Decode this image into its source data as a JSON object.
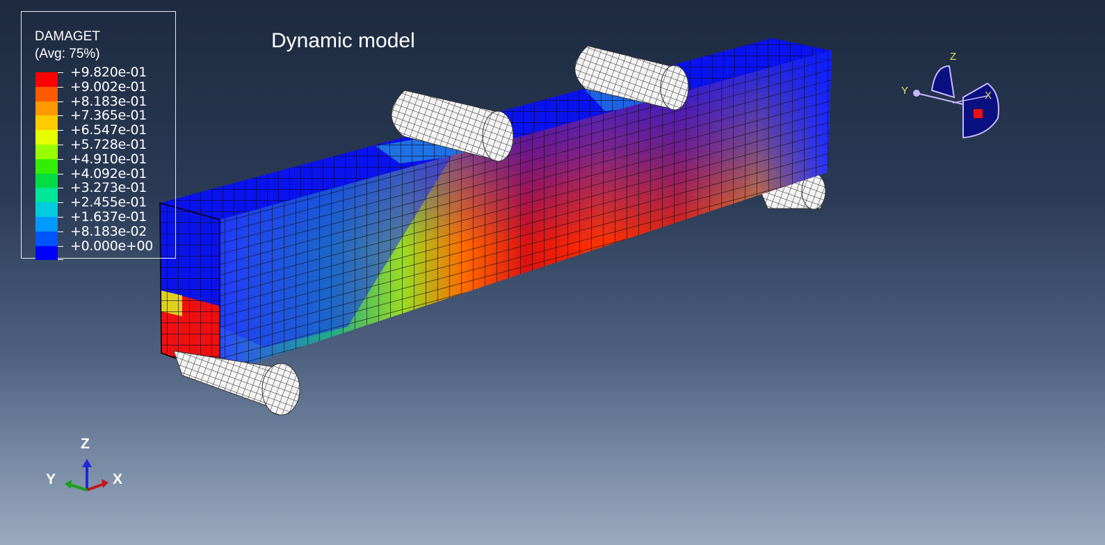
{
  "title": "Dynamic model",
  "legend": {
    "variable": "DAMAGET",
    "averaging": "(Avg: 75%)",
    "levels": [
      {
        "label": "+9.820e-01",
        "color": "#ff0000"
      },
      {
        "label": "+9.002e-01",
        "color": "#ff5a00"
      },
      {
        "label": "+8.183e-01",
        "color": "#ff9900"
      },
      {
        "label": "+7.365e-01",
        "color": "#ffcc00"
      },
      {
        "label": "+6.547e-01",
        "color": "#e6ff00"
      },
      {
        "label": "+5.728e-01",
        "color": "#99ff00"
      },
      {
        "label": "+4.910e-01",
        "color": "#33ee00"
      },
      {
        "label": "+4.092e-01",
        "color": "#00dd44"
      },
      {
        "label": "+3.273e-01",
        "color": "#00e699"
      },
      {
        "label": "+2.455e-01",
        "color": "#00ccdd"
      },
      {
        "label": "+1.637e-01",
        "color": "#0099ff"
      },
      {
        "label": "+8.183e-02",
        "color": "#0055ff"
      },
      {
        "label": "+0.000e+00",
        "color": "#0000ff"
      }
    ]
  },
  "triad": {
    "x": "X",
    "y": "Y",
    "z": "Z"
  },
  "view_cube": {
    "x": "X",
    "y": "Y",
    "z": "Z"
  }
}
